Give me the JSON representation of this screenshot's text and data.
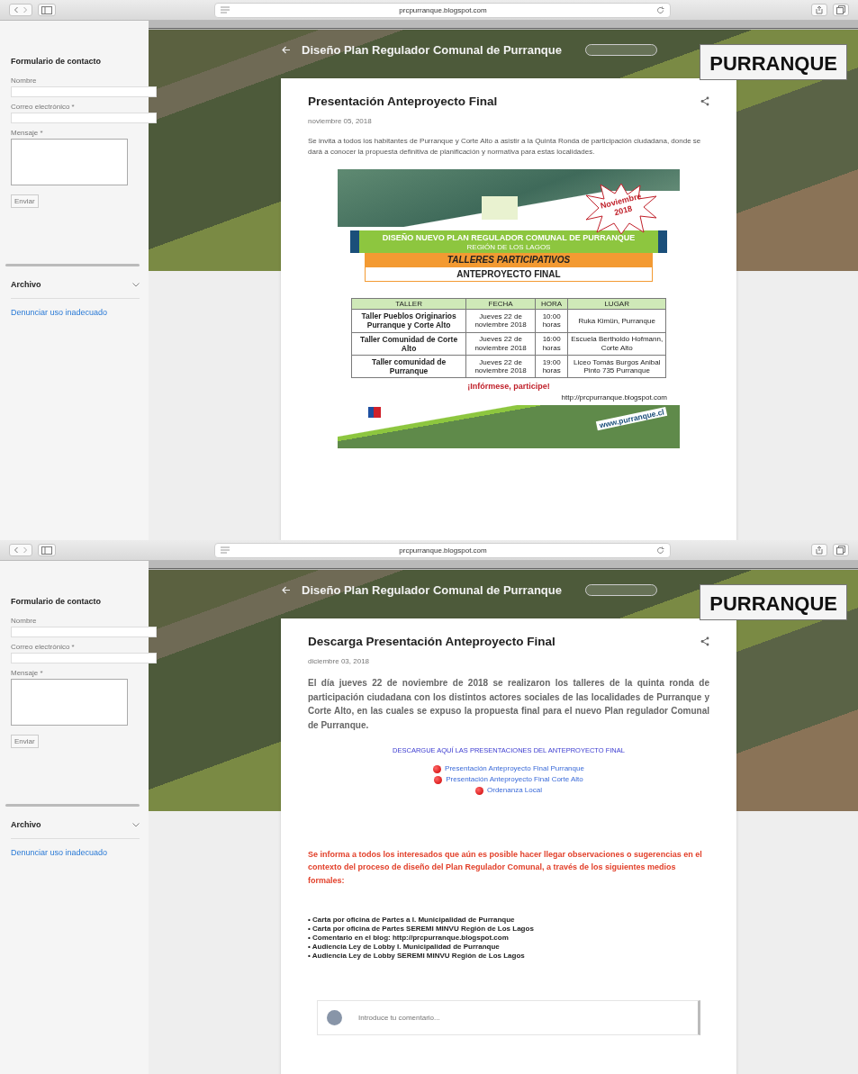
{
  "screens": [
    {
      "browser": {
        "url": "prcpurranque.blogspot.com"
      },
      "sidebar": {
        "form_title": "Formulario de contacto",
        "fields": [
          {
            "label": "Nombre",
            "kind": "input"
          },
          {
            "label": "Correo electrónico *",
            "kind": "input"
          },
          {
            "label": "Mensaje *",
            "kind": "textarea"
          }
        ],
        "submit": "Enviar",
        "archive": "Archivo",
        "report_link": "Denunciar uso inadecuado"
      },
      "header": {
        "title": "Diseño Plan Regulador Comunal de Purranque",
        "map_label": "PURRANQUE"
      },
      "post": {
        "kind": "poster",
        "title": "Presentación Anteproyecto Final",
        "date": "noviembre 05, 2018",
        "intro": "Se invita a todos los habitantes de Purranque y Corte Alto a asistir a la Quinta Ronda de participación ciudadana, donde se dará a conocer la propuesta definitiva de planificación y normativa para estas localidades.",
        "poster": {
          "badge": "Noviembre 2018",
          "headline": "DISEÑO NUEVO PLAN REGULADOR COMUNAL DE PURRANQUE",
          "region": "REGIÓN DE LOS LAGOS",
          "banner": "TALLERES PARTICIPATIVOS",
          "subtitle": "ANTEPROYECTO FINAL",
          "table": {
            "columns": [
              "TALLER",
              "FECHA",
              "HORA",
              "LUGAR"
            ],
            "rows": [
              [
                "Taller Pueblos Originarios Purranque y Corte Alto",
                "Jueves 22 de noviembre 2018",
                "10:00 horas",
                "Ruka Kimün, Purranque"
              ],
              [
                "Taller Comunidad de Corte Alto",
                "Jueves 22 de noviembre 2018",
                "16:00 horas",
                "Escuela Bertholdo Hofmann, Corte Alto"
              ],
              [
                "Taller comunidad de Purranque",
                "Jueves 22 de noviembre 2018",
                "19:00 horas",
                "Liceo Tomás Burgos Anibal Pinto 735 Purranque"
              ]
            ]
          },
          "call": "¡Infórmese, participe!",
          "blog_url": "http://prcpurranque.blogspot.com",
          "site": "www.purranque.cl"
        }
      }
    },
    {
      "browser": {
        "url": "prcpurranque.blogspot.com"
      },
      "sidebar": {
        "form_title": "Formulario de contacto",
        "fields": [
          {
            "label": "Nombre",
            "kind": "input"
          },
          {
            "label": "Correo electrónico *",
            "kind": "input"
          },
          {
            "label": "Mensaje *",
            "kind": "textarea"
          }
        ],
        "submit": "Enviar",
        "archive": "Archivo",
        "report_link": "Denunciar uso inadecuado"
      },
      "header": {
        "title": "Diseño Plan Regulador Comunal de Purranque",
        "map_label": "PURRANQUE"
      },
      "post": {
        "kind": "download",
        "title": "Descarga Presentación Anteproyecto Final",
        "date": "diciembre 03, 2018",
        "intro": "El día jueves 22 de noviembre de 2018 se realizaron los talleres de la quinta ronda de participación ciudadana con los distintos actores sociales de las localidades de Purranque y Corte Alto, en las cuales se expuso la propuesta final para el nuevo Plan regulador Comunal de Purranque.",
        "downloads": {
          "heading": "DESCARGUE AQUÍ LAS PRESENTACIONES DEL ANTEPROYECTO FINAL",
          "links": [
            "Presentación Anteproyecto Final Purranque",
            "Presentación Anteproyecto Final Corte Alto",
            "Ordenanza Local"
          ]
        },
        "notice": "Se informa a todos los interesados que aún es posible hacer llegar observaciones o sugerencias en el contexto del proceso de diseño del Plan Regulador Comunal, a través de los siguientes medios formales:",
        "channels": [
          "• Carta por oficina de Partes a I. Municipalidad de Purranque",
          "• Carta por oficina de Partes SEREMI MINVU Región de Los Lagos",
          "• Comentario en el blog: http://prcpurranque.blogspot.com",
          "• Audiencia Ley de Lobby I. Municipalidad de Purranque",
          "• Audiencia Ley de Lobby SEREMI MINVU Región de Los Lagos"
        ],
        "comment": {
          "placeholder": "Introduce tu comentario..."
        }
      }
    }
  ]
}
